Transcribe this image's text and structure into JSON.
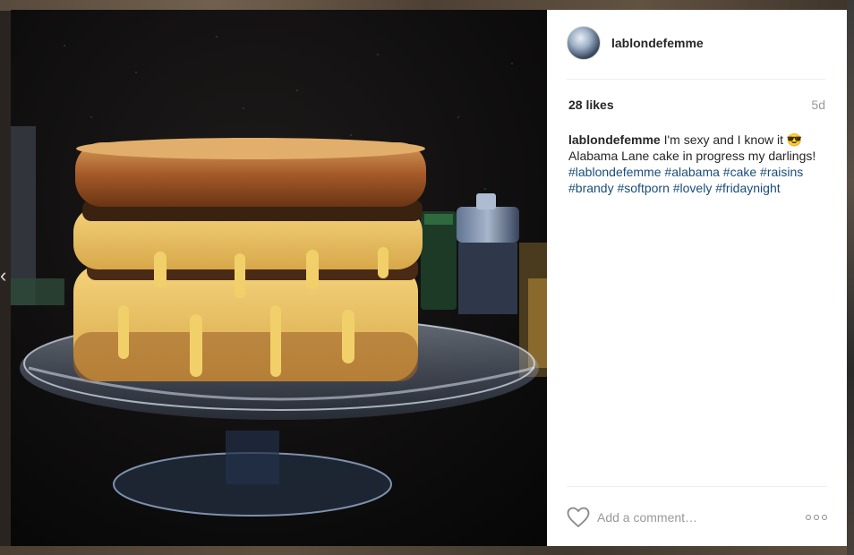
{
  "post": {
    "username": "lablondefemme",
    "likes": "28 likes",
    "age": "5d",
    "caption": {
      "username": "lablondefemme",
      "line1": "I'm sexy and I know it",
      "emoji": "😎",
      "line2": "Alabama Lane cake in progress my darlings!",
      "hashtags": [
        "#lablondefemme",
        "#alabama",
        "#cake",
        "#raisins",
        "#brandy",
        "#softporn",
        "#lovely",
        "#fridaynight"
      ]
    }
  },
  "footer": {
    "comment_placeholder": "Add a comment…"
  },
  "icons": {
    "like": "heart-icon",
    "more": "more-options-icon",
    "prev": "chevron-left-icon"
  }
}
